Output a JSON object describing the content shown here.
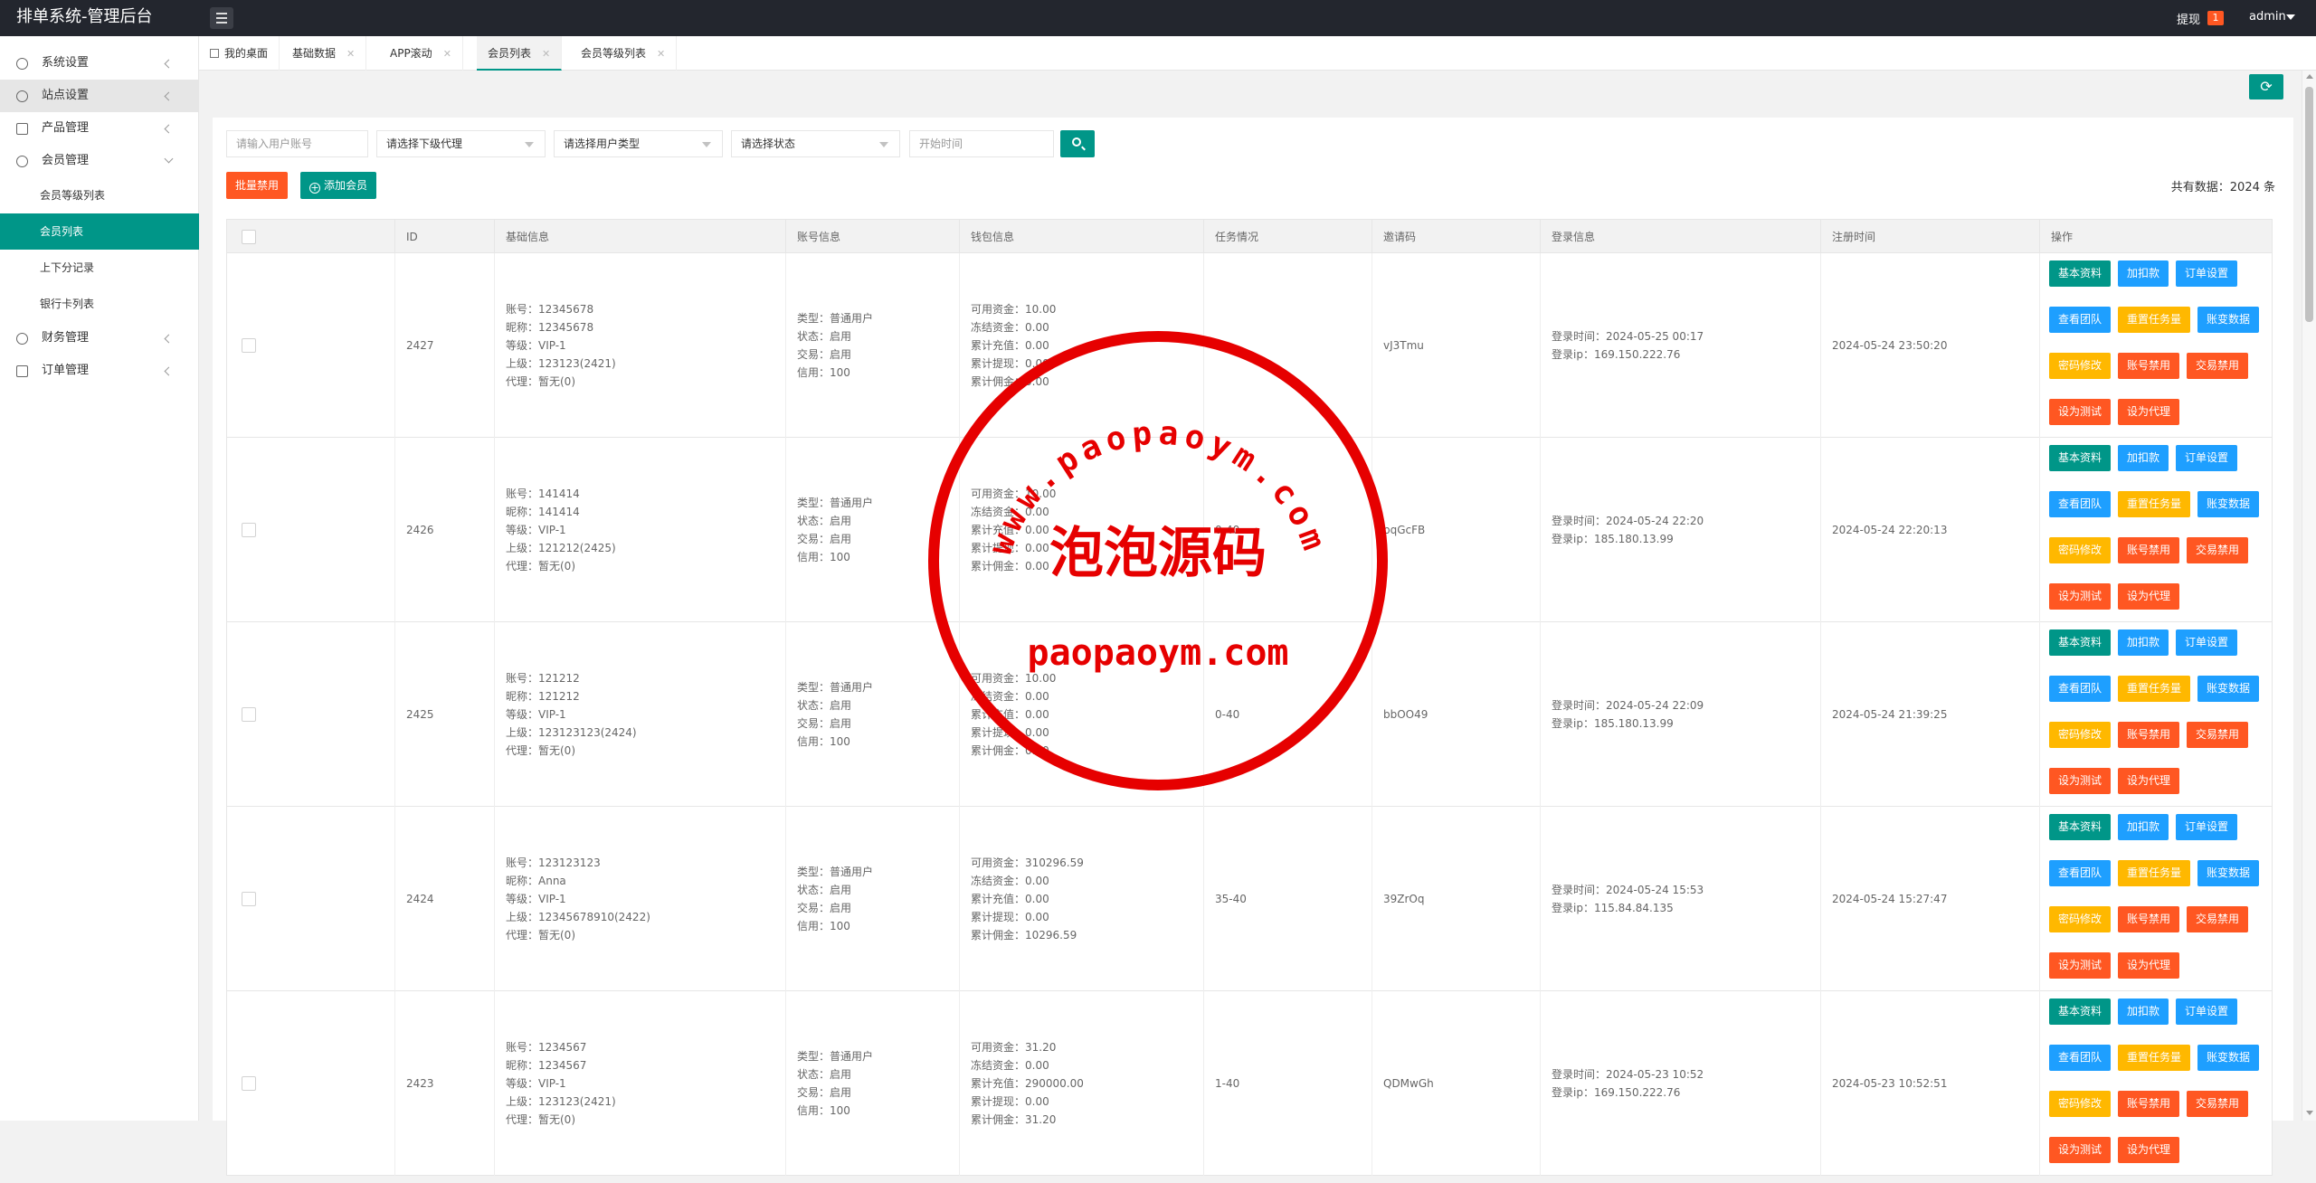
{
  "app": {
    "title": "排单系统-管理后台"
  },
  "topbar": {
    "withdraw_label": "提现",
    "withdraw_count": "1",
    "user": "admin"
  },
  "sidebar": {
    "items": [
      {
        "label": "系统设置",
        "icon": "gear-icon"
      },
      {
        "label": "站点设置",
        "icon": "globe-icon"
      },
      {
        "label": "产品管理",
        "icon": "box-icon"
      },
      {
        "label": "会员管理",
        "icon": "user-icon"
      },
      {
        "label": "会员等级列表"
      },
      {
        "label": "会员列表"
      },
      {
        "label": "上下分记录"
      },
      {
        "label": "银行卡列表"
      },
      {
        "label": "财务管理",
        "icon": "dollar-icon"
      },
      {
        "label": "订单管理",
        "icon": "box-icon"
      }
    ]
  },
  "tabs": [
    {
      "label": "我的桌面"
    },
    {
      "label": "基础数据"
    },
    {
      "label": "APP滚动"
    },
    {
      "label": "会员列表"
    },
    {
      "label": "会员等级列表"
    }
  ],
  "filters": {
    "account_placeholder": "请输入用户账号",
    "agent_select": "请选择下级代理",
    "usertype_select": "请选择用户类型",
    "status_select": "请选择状态",
    "start_time_placeholder": "开始时间"
  },
  "actions": {
    "batch_disable": "批量禁用",
    "add_member": "添加会员"
  },
  "summary": {
    "total_label": "共有数据：2024 条"
  },
  "table": {
    "headers": [
      "ID",
      "基础信息",
      "账号信息",
      "钱包信息",
      "任务情况",
      "邀请码",
      "登录信息",
      "注册时间",
      "操作"
    ],
    "op_buttons": [
      "基本资料",
      "加扣款",
      "订单设置",
      "查看团队",
      "重置任务量",
      "账变数据",
      "密码修改",
      "账号禁用",
      "交易禁用",
      "设为测试",
      "设为代理"
    ],
    "rows": [
      {
        "id": "2427",
        "basic": [
          "账号：12345678",
          "昵称：12345678",
          "等级：VIP-1",
          "上级：123123(2421)",
          "代理：暂无(0)"
        ],
        "account": [
          "类型：普通用户",
          "状态：启用",
          "交易：启用",
          "信用：100"
        ],
        "wallet": [
          "可用资金：10.00",
          "冻结资金：0.00",
          "累计充值：0.00",
          "累计提现：0.00",
          "累计佣金：0.00"
        ],
        "task": "",
        "invite": "vJ3Tmu",
        "login": [
          "登录时间：2024-05-25 00:17",
          "登录ip：169.150.222.76"
        ],
        "reg": "2024-05-24 23:50:20"
      },
      {
        "id": "2426",
        "basic": [
          "账号：141414",
          "昵称：141414",
          "等级：VIP-1",
          "上级：121212(2425)",
          "代理：暂无(0)"
        ],
        "account": [
          "类型：普通用户",
          "状态：启用",
          "交易：启用",
          "信用：100"
        ],
        "wallet": [
          "可用资金：10.00",
          "冻结资金：0.00",
          "累计充值：0.00",
          "累计提现：0.00",
          "累计佣金：0.00"
        ],
        "task": "0-40",
        "invite": "pqGcFB",
        "login": [
          "登录时间：2024-05-24 22:20",
          "登录ip：185.180.13.99"
        ],
        "reg": "2024-05-24 22:20:13"
      },
      {
        "id": "2425",
        "basic": [
          "账号：121212",
          "昵称：121212",
          "等级：VIP-1",
          "上级：123123123(2424)",
          "代理：暂无(0)"
        ],
        "account": [
          "类型：普通用户",
          "状态：启用",
          "交易：启用",
          "信用：100"
        ],
        "wallet": [
          "可用资金：10.00",
          "冻结资金：0.00",
          "累计充值：0.00",
          "累计提现：0.00",
          "累计佣金：0.00"
        ],
        "task": "0-40",
        "invite": "bbOO49",
        "login": [
          "登录时间：2024-05-24 22:09",
          "登录ip：185.180.13.99"
        ],
        "reg": "2024-05-24 21:39:25"
      },
      {
        "id": "2424",
        "basic": [
          "账号：123123123",
          "昵称：Anna",
          "等级：VIP-1",
          "上级：12345678910(2422)",
          "代理：暂无(0)"
        ],
        "account": [
          "类型：普通用户",
          "状态：启用",
          "交易：启用",
          "信用：100"
        ],
        "wallet": [
          "可用资金：310296.59",
          "冻结资金：0.00",
          "累计充值：0.00",
          "累计提现：0.00",
          "累计佣金：10296.59"
        ],
        "task": "35-40",
        "invite": "39ZrOq",
        "login": [
          "登录时间：2024-05-24 15:53",
          "登录ip：115.84.84.135"
        ],
        "reg": "2024-05-24 15:27:47"
      },
      {
        "id": "2423",
        "basic": [
          "账号：1234567",
          "昵称：1234567",
          "等级：VIP-1",
          "上级：123123(2421)",
          "代理：暂无(0)"
        ],
        "account": [
          "类型：普通用户",
          "状态：启用",
          "交易：启用",
          "信用：100"
        ],
        "wallet": [
          "可用资金：31.20",
          "冻结资金：0.00",
          "累计充值：290000.00",
          "累计提现：0.00",
          "累计佣金：31.20"
        ],
        "task": "1-40",
        "invite": "QDMwGh",
        "login": [
          "登录时间：2024-05-23 10:52",
          "登录ip：169.150.222.76"
        ],
        "reg": "2024-05-23 10:52:51"
      }
    ]
  },
  "watermark": {
    "top_arc": "www.paopaoym.com",
    "middle": "泡泡源码",
    "bottom": "paopaoym.com"
  },
  "colors": {
    "primary": "#009688",
    "blue": "#1e9fff",
    "orange": "#ffb800",
    "red": "#ff5722",
    "topbar": "#23262e",
    "watermark": "#e60000"
  }
}
